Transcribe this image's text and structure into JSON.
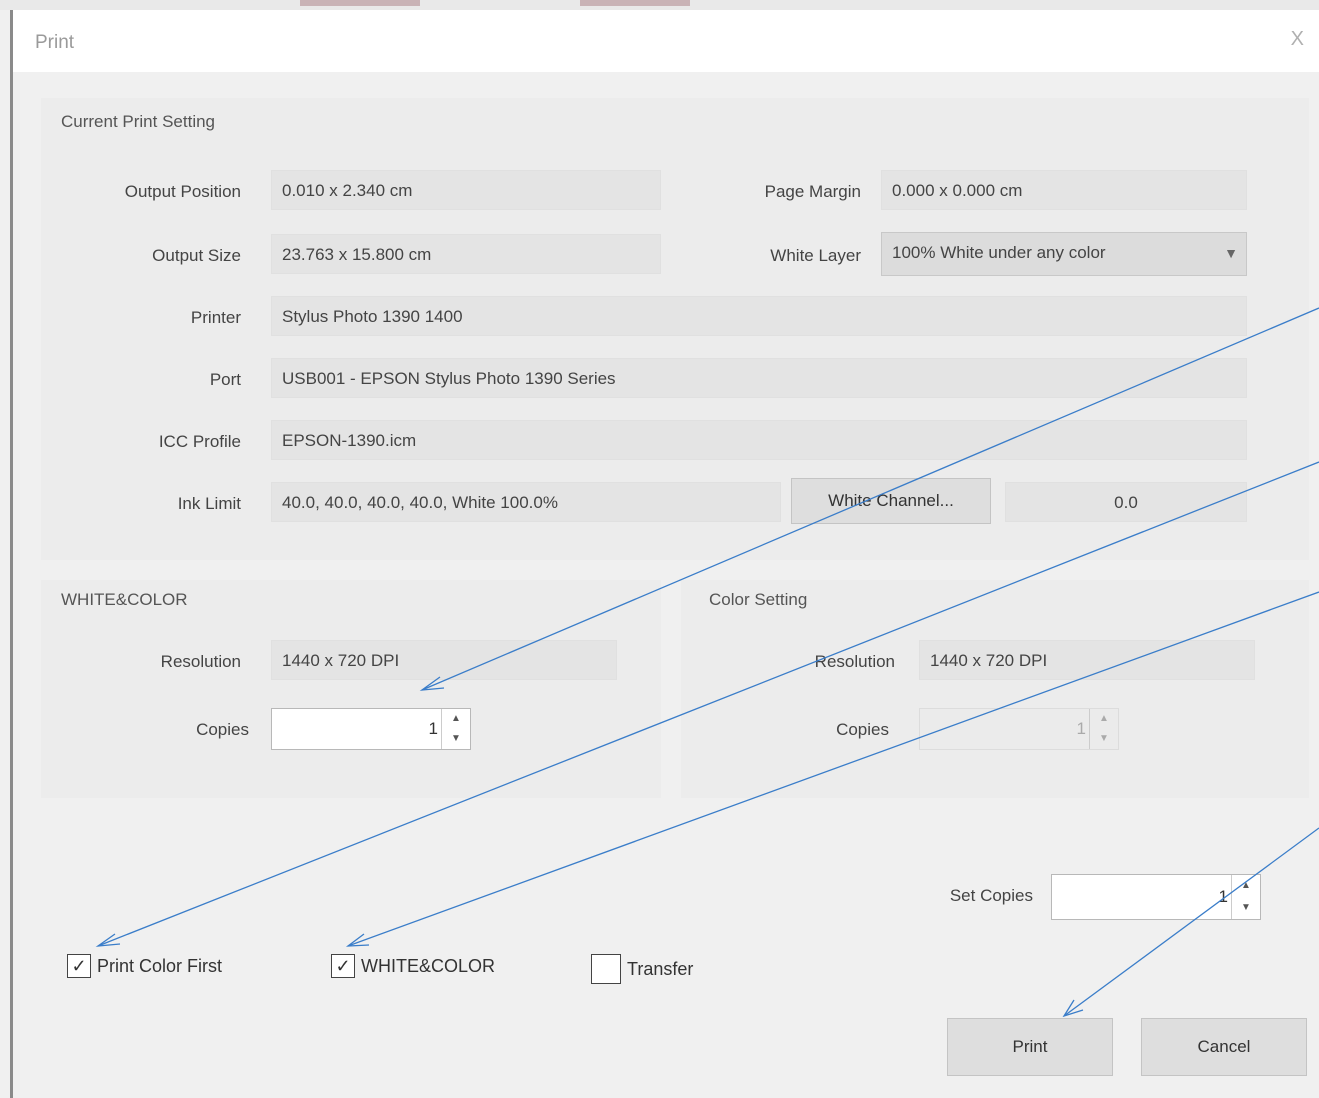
{
  "dialog": {
    "title": "Print",
    "close_label": "X"
  },
  "current_print_setting": {
    "group_label": "Current Print Setting",
    "output_position": {
      "label": "Output Position",
      "value": "0.010 x 2.340 cm"
    },
    "page_margin": {
      "label": "Page Margin",
      "value": "0.000 x 0.000 cm"
    },
    "output_size": {
      "label": "Output Size",
      "value": "23.763 x 15.800 cm"
    },
    "white_layer": {
      "label": "White Layer",
      "value": "100% White under any color"
    },
    "printer": {
      "label": "Printer",
      "value": "Stylus Photo 1390 1400"
    },
    "port": {
      "label": "Port",
      "value": "USB001 - EPSON Stylus Photo 1390 Series"
    },
    "icc_profile": {
      "label": "ICC Profile",
      "value": "EPSON-1390.icm"
    },
    "ink_limit": {
      "label": "Ink Limit",
      "value": "40.0, 40.0, 40.0, 40.0, White 100.0%"
    },
    "white_channel_button": "White Channel...",
    "white_channel_value": "0.0"
  },
  "white_color_group": {
    "group_label": "WHITE&COLOR",
    "resolution": {
      "label": "Resolution",
      "value": "1440 x 720 DPI"
    },
    "copies": {
      "label": "Copies",
      "value": "1"
    }
  },
  "color_setting_group": {
    "group_label": "Color Setting",
    "resolution": {
      "label": "Resolution",
      "value": "1440 x 720 DPI"
    },
    "copies": {
      "label": "Copies",
      "value": "1"
    }
  },
  "set_copies": {
    "label": "Set Copies",
    "value": "1"
  },
  "checkboxes": [
    {
      "label": "Print Color First",
      "checked": true
    },
    {
      "label": "WHITE&COLOR",
      "checked": true
    },
    {
      "label": "Transfer",
      "checked": false
    }
  ],
  "buttons": {
    "print": "Print",
    "cancel": "Cancel"
  },
  "annotation_color": "#3a7dc9"
}
